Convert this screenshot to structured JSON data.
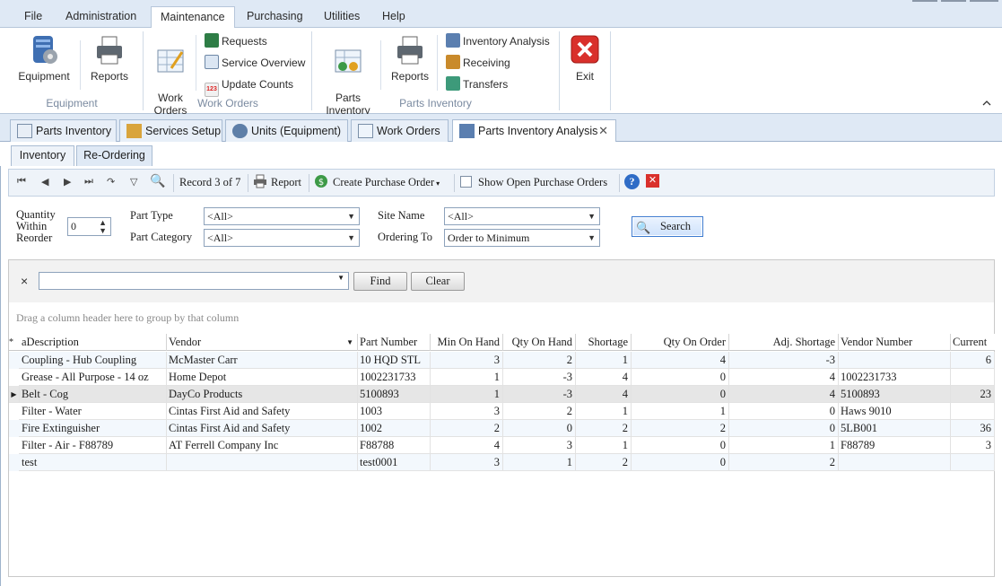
{
  "menu": [
    "File",
    "Administration",
    "Maintenance",
    "Purchasing",
    "Utilities",
    "Help"
  ],
  "ribbon": {
    "equipment_group": {
      "label": "Equipment",
      "equipment": "Equipment",
      "reports": "Reports"
    },
    "workorders_group": {
      "label": "Work Orders",
      "work_orders": "Work\nOrders",
      "requests": "Requests",
      "service_overview": "Service Overview",
      "update_counts": "Update Counts"
    },
    "parts_group": {
      "label": "Parts Inventory",
      "parts_inventory": "Parts\nInventory",
      "reports": "Reports",
      "inventory_analysis": "Inventory Analysis",
      "receiving": "Receiving",
      "transfers": "Transfers"
    },
    "exit": "Exit"
  },
  "doc_tabs": [
    "Parts Inventory",
    "Services Setup",
    "Units (Equipment)",
    "Work Orders",
    "Parts Inventory Analysis"
  ],
  "sub_tabs": [
    "Inventory",
    "Re-Ordering"
  ],
  "toolbar": {
    "record": "Record 3 of 7",
    "report": "Report",
    "create_po": "Create Purchase Order",
    "show_open_po": "Show Open Purchase Orders"
  },
  "filters": {
    "qty_label": "Quantity\nWithin\nReorder",
    "qty_value": "0",
    "part_type_label": "Part Type",
    "part_type_value": "<All>",
    "part_category_label": "Part Category",
    "part_category_value": "<All>",
    "site_name_label": "Site Name",
    "site_name_value": "<All>",
    "ordering_to_label": "Ordering To",
    "ordering_to_value": "Order to Minimum",
    "search": "Search"
  },
  "find": {
    "find": "Find",
    "clear": "Clear",
    "close": "×"
  },
  "grid": {
    "group_hint": "Drag a column header here to group by that column",
    "columns": [
      "aDescription",
      "Vendor",
      "Part Number",
      "Min On Hand",
      "Qty On Hand",
      "Shortage",
      "Qty On Order",
      "Adj. Shortage",
      "Vendor Number",
      "Current"
    ],
    "rows": [
      [
        "Coupling - Hub Coupling",
        "McMaster Carr",
        "10 HQD STL",
        "3",
        "2",
        "1",
        "4",
        "-3",
        "",
        "6"
      ],
      [
        "Grease - All Purpose - 14 oz",
        "Home Depot",
        "1002231733",
        "1",
        "-3",
        "4",
        "0",
        "4",
        "1002231733",
        ""
      ],
      [
        "Belt - Cog",
        "DayCo Products",
        "5100893",
        "1",
        "-3",
        "4",
        "0",
        "4",
        "5100893",
        "23"
      ],
      [
        "Filter - Water",
        "Cintas First Aid and Safety",
        "1003",
        "3",
        "2",
        "1",
        "1",
        "0",
        "Haws 9010",
        ""
      ],
      [
        "Fire Extinguisher",
        "Cintas First Aid and Safety",
        "1002",
        "2",
        "0",
        "2",
        "2",
        "0",
        "5LB001",
        "36"
      ],
      [
        "Filter - Air - F88789",
        "AT Ferrell Company Inc",
        "F88788",
        "4",
        "3",
        "1",
        "0",
        "1",
        "F88789",
        "3"
      ],
      [
        "test",
        "",
        "test0001",
        "3",
        "1",
        "2",
        "0",
        "2",
        "",
        ""
      ]
    ]
  }
}
